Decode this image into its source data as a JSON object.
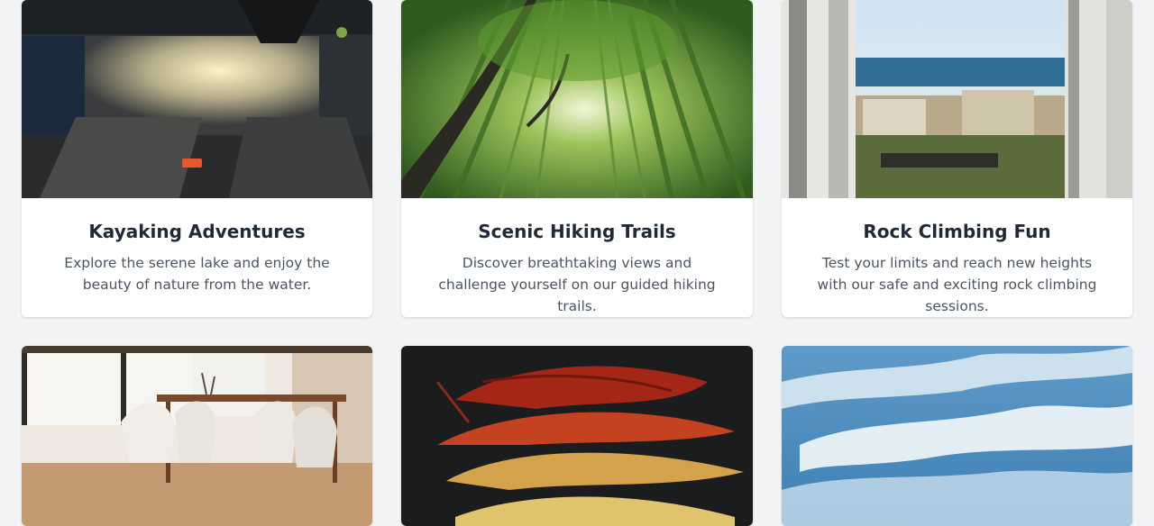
{
  "cards": [
    {
      "title": "Kayaking Adventures",
      "description": "Explore the serene lake and enjoy the beauty of nature from the water."
    },
    {
      "title": "Scenic Hiking Trails",
      "description": "Discover breathtaking views and challenge yourself on our guided hiking trails."
    },
    {
      "title": "Rock Climbing Fun",
      "description": "Test your limits and reach new heights with our safe and exciting rock climbing sessions."
    }
  ],
  "colors": {
    "page_background": "#f3f4f6",
    "card_background": "#ffffff",
    "title_text": "#1f2937",
    "body_text": "#4b5563"
  },
  "icons": {
    "card_1_image": "city-reflection-image",
    "card_2_image": "bamboo-forest-image",
    "card_3_image": "ocean-buildings-image",
    "card_4_image": "dining-room-image",
    "card_5_image": "autumn-leaves-image",
    "card_6_image": "cloudy-sky-image"
  }
}
